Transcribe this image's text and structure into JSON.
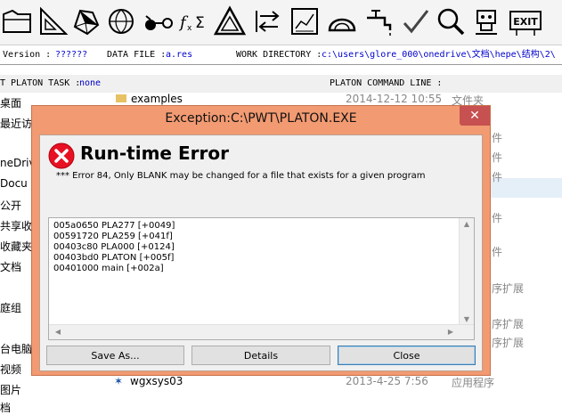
{
  "toolbar": {
    "tools": [
      {
        "name": "folder-tool-icon"
      },
      {
        "name": "set-square-tool-icon"
      },
      {
        "name": "polyhedron-tool-icon"
      },
      {
        "name": "globe-tool-icon"
      },
      {
        "name": "molecule-tool-icon"
      },
      {
        "name": "function-sum-tool-icon"
      },
      {
        "name": "triangle-tool-icon"
      },
      {
        "name": "arrows-tool-icon"
      },
      {
        "name": "chart-tool-icon"
      },
      {
        "name": "helmet-tool-icon"
      },
      {
        "name": "faucet-tool-icon"
      },
      {
        "name": "checkmark-tool-icon"
      },
      {
        "name": "magnifier-tool-icon"
      },
      {
        "name": "robot-tool-icon"
      },
      {
        "name": "exit-tool-icon",
        "label": "EXIT"
      }
    ]
  },
  "info": {
    "version_label": "Version :",
    "version_value": "??????",
    "datafile_label": "DATA FILE :",
    "datafile_value": "a.res",
    "workdir_label": "WORK DIRECTORY :",
    "workdir_value": "c:\\users\\glore_000\\onedrive\\文档\\hepe\\结构\\2\\"
  },
  "task": {
    "task_label": "T PLATON TASK :",
    "task_value": "none",
    "command_label": "PLATON COMMAND LINE :"
  },
  "background": {
    "examples_name": "examples",
    "examples_date": "2014-12-12 10:55",
    "examples_type": "文件夹",
    "sidebar": [
      "桌面",
      "最近访",
      "neDriv",
      "Docu",
      "公开",
      "共享收",
      "收藏夹",
      "文档",
      "庭组",
      "台电脑",
      "视频",
      "图片",
      "档"
    ],
    "right_fragments": [
      "件",
      "件",
      "件",
      "件",
      "件",
      "序扩展",
      "序扩展",
      "序扩展"
    ],
    "last_name": "wgxsys03",
    "last_date": "2013-4-25 7:56",
    "last_type": "应用程序"
  },
  "dialog": {
    "title": "Exception:C:\\PWT\\PLATON.EXE",
    "close_symbol": "✕",
    "heading": "Run-time Error",
    "message": "*** Error   84, Only BLANK may be changed for a file that exists for a given program",
    "trace": [
      "005a0650 PLA277 [+0049]",
      "00591720 PLA259 [+041f]",
      "00403c80 PLA000 [+0124]",
      "00403bd0 PLATON [+005f]",
      "00401000 main [+002a]"
    ],
    "buttons": {
      "save_as": "Save As...",
      "details": "Details",
      "close": "Close"
    }
  }
}
